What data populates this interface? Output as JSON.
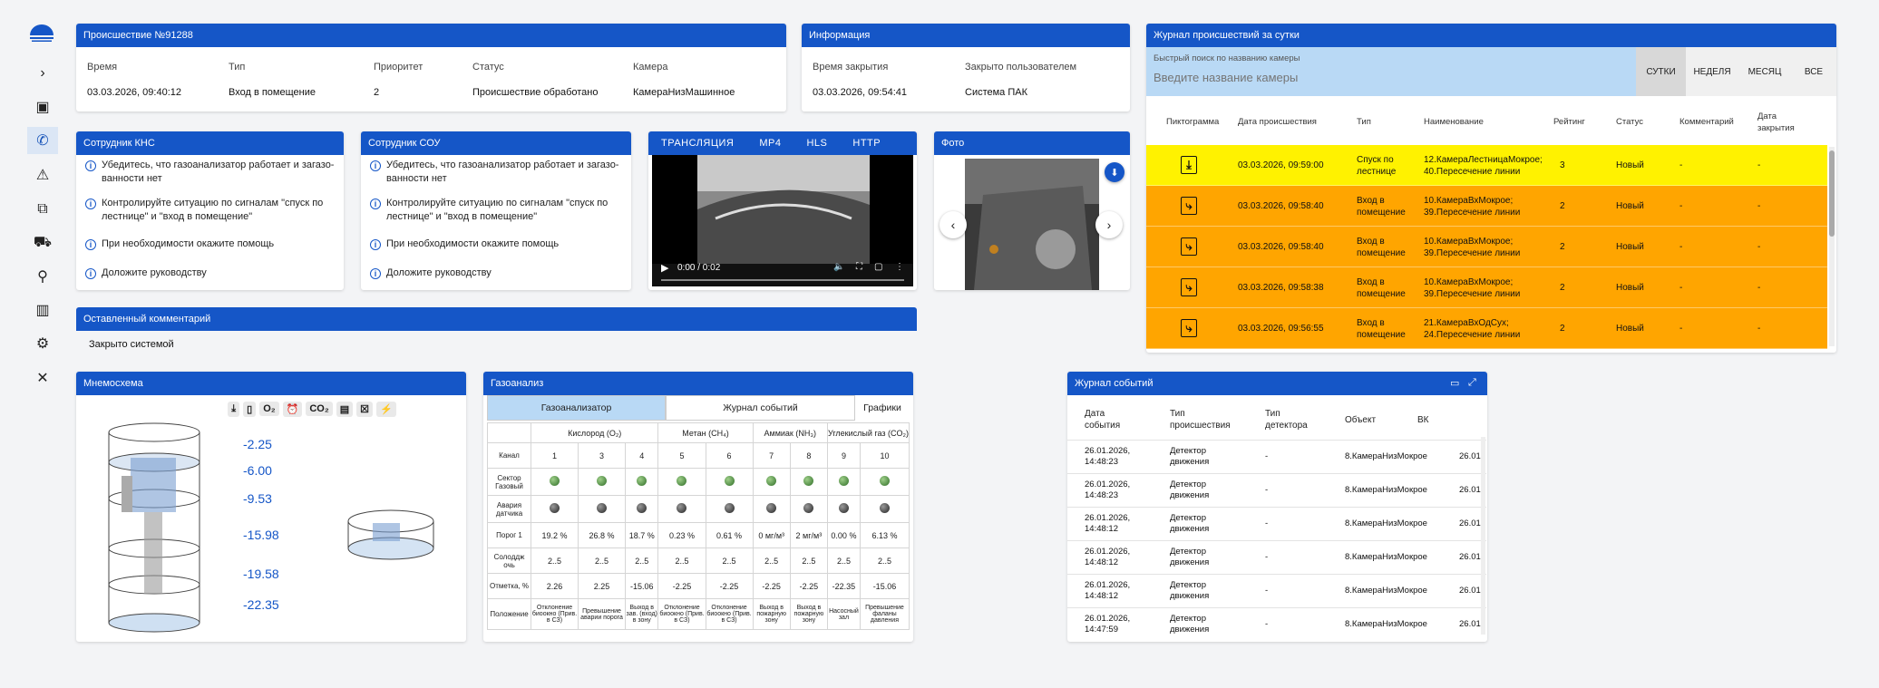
{
  "sidebar": {
    "icons": [
      "chevron-right-icon",
      "monitor-icon",
      "phone-icon",
      "alert-icon",
      "cameras-icon",
      "vehicle-icon",
      "person-pin-icon",
      "analytics-icon",
      "settings-icon",
      "tools-icon"
    ],
    "active_index": 2
  },
  "incident": {
    "title": "Происшествие №91288",
    "labels": {
      "time": "Время",
      "type": "Тип",
      "priority": "Приоритет",
      "status": "Статус",
      "camera": "Камера"
    },
    "values": {
      "time": "03.03.2026, 09:40:12",
      "type": "Вход в помещение",
      "priority": "2",
      "status": "Происшествие обработано",
      "camera": "КамераНизМашинное"
    }
  },
  "info": {
    "title": "Информация",
    "labels": {
      "closed_time": "Время закрытия",
      "closed_by": "Закрыто пользователем"
    },
    "values": {
      "closed_time": "03.03.2026, 09:54:41",
      "closed_by": "Система ПАК"
    }
  },
  "kns": {
    "title": "Сотрудник КНС",
    "items": [
      "Убедитесь, что газоанализатор работает и загазо-ванности нет",
      "Контролируйте ситуацию по сигналам \"спуск по лестнице\" и \"вход в помещение\"",
      "При необходимости окажите помощь",
      "Доложите руководству"
    ]
  },
  "sou": {
    "title": "Сотрудник СОУ",
    "items": [
      "Убедитесь, что газоанализатор работает и загазо-ванности нет",
      "Контролируйте ситуацию по сигналам \"спуск по лестнице\" и \"вход в помещение\"",
      "При необходимости окажите помощь",
      "Доложите руководству"
    ]
  },
  "stream": {
    "tabs": [
      "ТРАНСЛЯЦИЯ",
      "MP4",
      "HLS",
      "HTTP"
    ],
    "time": "0:00 / 0:02"
  },
  "photo": {
    "title": "Фото"
  },
  "comment": {
    "title": "Оставленный комментарий",
    "text": "Закрыто системой"
  },
  "journal": {
    "title": "Журнал происшествий за сутки",
    "search_label": "Быстрый поиск по названию камеры",
    "search_placeholder": "Введите название камеры",
    "periods": [
      "СУТКИ",
      "НЕДЕЛЯ",
      "МЕСЯЦ",
      "ВСЕ"
    ],
    "columns": [
      "Пиктограмма",
      "Дата происшествия",
      "Тип",
      "Наименование",
      "Рейтинг",
      "Статус",
      "Комментарий",
      "Дата закрытия"
    ],
    "rows": [
      {
        "date": "03.03.2026, 09:59:00",
        "type": "Спуск по лестнице",
        "name": "12.КамераЛестницаМокрое; 40.Пересечение линии",
        "rating": "3",
        "status": "Новый",
        "comment": "-",
        "closed": "-",
        "color": "#fff200",
        "icon": "stairs-icon"
      },
      {
        "date": "03.03.2026, 09:58:40",
        "type": "Вход в помещение",
        "name": "10.КамераВхМокрое; 39.Пересечение линии",
        "rating": "2",
        "status": "Новый",
        "comment": "-",
        "closed": "-",
        "color": "#ffa500",
        "icon": "door-entry-icon"
      },
      {
        "date": "03.03.2026, 09:58:40",
        "type": "Вход в помещение",
        "name": "10.КамераВхМокрое; 39.Пересечение линии",
        "rating": "2",
        "status": "Новый",
        "comment": "-",
        "closed": "-",
        "color": "#ffa500",
        "icon": "door-entry-icon"
      },
      {
        "date": "03.03.2026, 09:58:38",
        "type": "Вход в помещение",
        "name": "10.КамераВхМокрое; 39.Пересечение линии",
        "rating": "2",
        "status": "Новый",
        "comment": "-",
        "closed": "-",
        "color": "#ffa500",
        "icon": "door-entry-icon"
      },
      {
        "date": "03.03.2026, 09:56:55",
        "type": "Вход в помещение",
        "name": "21.КамераВхОдСух; 24.Пересечение линии",
        "rating": "2",
        "status": "Новый",
        "comment": "-",
        "closed": "-",
        "color": "#ffa500",
        "icon": "door-entry-icon"
      }
    ]
  },
  "mnemo": {
    "title": "Мнемосхема",
    "depths": [
      "-2.25",
      "-6.00",
      "-9.53",
      "-15.98",
      "-19.58",
      "-22.35"
    ]
  },
  "gas": {
    "title": "Газоанализ",
    "tabs": [
      "Газоанализатор",
      "Журнал событий",
      "Графики"
    ],
    "groups": [
      "Кислород (O₂)",
      "Метан (CH₄)",
      "Аммиак (NH₃)",
      "Углекислый газ (CO₂)"
    ],
    "row_labels": [
      "Канал",
      "Сектор Газовый",
      "Авария датчика",
      "Порог 1",
      "Солоддж очь",
      "Отметка, %",
      "Положение"
    ],
    "channels": [
      "1",
      "3",
      "4",
      "5",
      "6",
      "7",
      "8",
      "9",
      "10"
    ],
    "porog": [
      "19.2 %",
      "26.8 %",
      "18.7 %",
      "0.23 %",
      "0.61 %",
      "0 мг/м³",
      "2 мг/м³",
      "0.00 %",
      "6.13 %"
    ],
    "range": [
      "2..5",
      "2..5",
      "2..5",
      "2..5",
      "2..5",
      "2..5",
      "2..5",
      "2..5",
      "2..5"
    ],
    "mark": [
      "2.26",
      "2.25",
      "-15.06",
      "-2.25",
      "-2.25",
      "-2.25",
      "-2.25",
      "-22.35",
      "-15.06"
    ],
    "position": [
      "Отклонение биоокно (Прив. в СЗ)",
      "Превышение аварии порога",
      "Выход в зав. (вход) в зону",
      "Отклонение биоокно (Прив. в СЗ)",
      "Отклонение биоокно (Прив. в СЗ)",
      "Выход в пожарную зону",
      "Выход в пожарную зону",
      "Насосный зал",
      "Превышение фаланы давления"
    ]
  },
  "events": {
    "title": "Журнал событий",
    "columns": [
      "Дата события",
      "Тип происшествия",
      "Тип детектора",
      "Объект",
      "ВК"
    ],
    "rows": [
      {
        "date": "26.01.2026, 14:48:23",
        "type": "Детектор движения",
        "det": "-",
        "obj": "8.КамераНизМокрое",
        "vk": "26.01"
      },
      {
        "date": "26.01.2026, 14:48:23",
        "type": "Детектор движения",
        "det": "-",
        "obj": "8.КамераНизМокрое",
        "vk": "26.01"
      },
      {
        "date": "26.01.2026, 14:48:12",
        "type": "Детектор движения",
        "det": "-",
        "obj": "8.КамераНизМокрое",
        "vk": "26.01"
      },
      {
        "date": "26.01.2026, 14:48:12",
        "type": "Детектор движения",
        "det": "-",
        "obj": "8.КамераНизМокрое",
        "vk": "26.01"
      },
      {
        "date": "26.01.2026, 14:48:12",
        "type": "Детектор движения",
        "det": "-",
        "obj": "8.КамераНизМокрое",
        "vk": "26.01"
      },
      {
        "date": "26.01.2026, 14:47:59",
        "type": "Детектор движения",
        "det": "-",
        "obj": "8.КамераНизМокрое",
        "vk": "26.01"
      }
    ]
  }
}
